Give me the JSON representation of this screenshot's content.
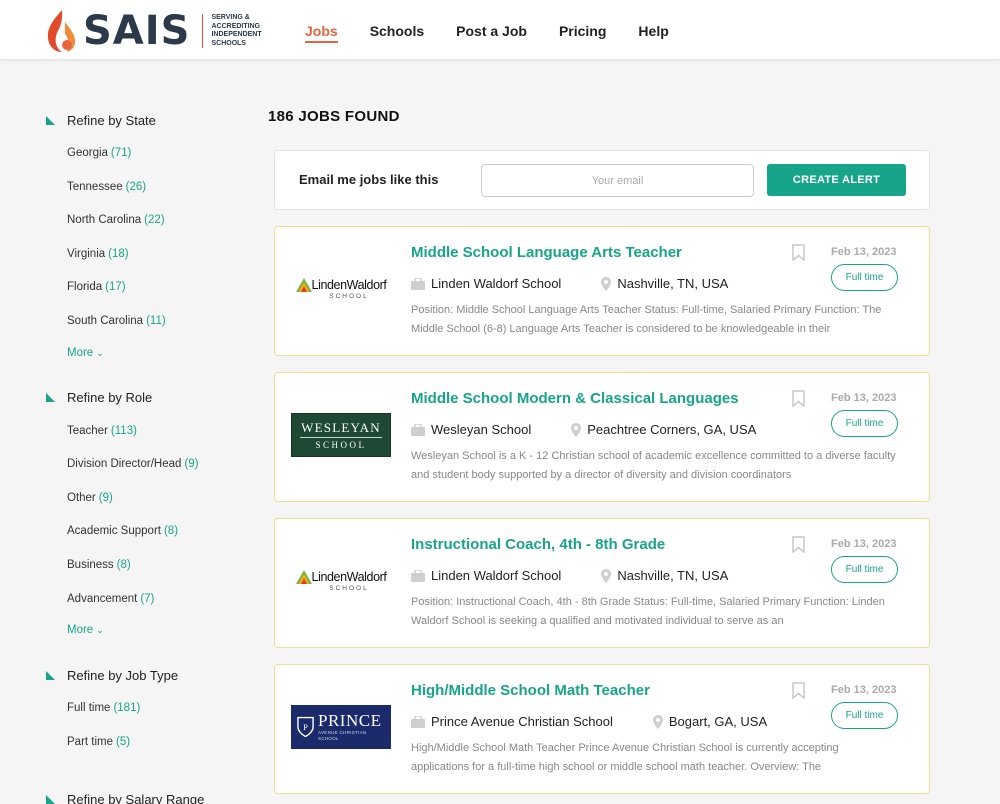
{
  "brand": {
    "name": "SAIS",
    "tagline": [
      "SERVING &",
      "ACCREDITING",
      "INDEPENDENT",
      "SCHOOLS"
    ],
    "accent": "#e8643c",
    "navy": "#2b3a4a"
  },
  "nav": {
    "items": [
      {
        "label": "Jobs",
        "active": true
      },
      {
        "label": "Schools"
      },
      {
        "label": "Post a Job"
      },
      {
        "label": "Pricing"
      },
      {
        "label": "Help"
      }
    ]
  },
  "colors": {
    "teal": "#17a589",
    "card_border": "#f0e08a"
  },
  "filters": {
    "state": {
      "title": "Refine by State",
      "items": [
        {
          "label": "Georgia",
          "count": "(71)"
        },
        {
          "label": "Tennessee",
          "count": "(26)"
        },
        {
          "label": "North Carolina",
          "count": "(22)"
        },
        {
          "label": "Virginia",
          "count": "(18)"
        },
        {
          "label": "Florida",
          "count": "(17)"
        },
        {
          "label": "South Carolina",
          "count": "(11)"
        }
      ],
      "more": "More"
    },
    "role": {
      "title": "Refine by Role",
      "items": [
        {
          "label": "Teacher",
          "count": "(113)"
        },
        {
          "label": "Division Director/Head",
          "count": "(9)"
        },
        {
          "label": "Other",
          "count": "(9)"
        },
        {
          "label": "Academic Support",
          "count": "(8)"
        },
        {
          "label": "Business",
          "count": "(8)"
        },
        {
          "label": "Advancement",
          "count": "(7)"
        }
      ],
      "more": "More"
    },
    "job_type": {
      "title": "Refine by Job Type",
      "items": [
        {
          "label": "Full time",
          "count": "(181)"
        },
        {
          "label": "Part time",
          "count": "(5)"
        }
      ]
    },
    "salary": {
      "title": "Refine by Salary Range"
    }
  },
  "results": {
    "count_label": "186 JOBS FOUND"
  },
  "alert": {
    "label": "Email me jobs like this",
    "placeholder": "Your email",
    "button": "CREATE ALERT"
  },
  "jobs": [
    {
      "title": "Middle School Language Arts Teacher",
      "school": "Linden Waldorf School",
      "location": "Nashville, TN, USA",
      "date": "Feb 13, 2023",
      "type": "Full time",
      "desc": "Position: Middle School Language Arts Teacher Status: Full-time, Salaried Primary Function: The Middle School (6-8) Language Arts Teacher is considered to be knowledgeable in their",
      "logo": "linden"
    },
    {
      "title": "Middle School Modern & Classical Languages",
      "school": "Wesleyan School",
      "location": "Peachtree Corners, GA, USA",
      "date": "Feb 13, 2023",
      "type": "Full time",
      "desc": "Wesleyan School is a K - 12 Christian school of academic excellence committed to a diverse faculty and student body supported by a director of diversity and division coordinators",
      "logo": "wesleyan"
    },
    {
      "title": "Instructional Coach, 4th - 8th Grade",
      "school": "Linden Waldorf School",
      "location": "Nashville, TN, USA",
      "date": "Feb 13, 2023",
      "type": "Full time",
      "desc": "Position: Instructional Coach, 4th - 8th Grade Status: Full-time, Salaried Primary Function: Linden Waldorf School is seeking a qualified and motivated individual to serve as an",
      "logo": "linden"
    },
    {
      "title": "High/Middle School Math Teacher",
      "school": "Prince Avenue Christian School",
      "location": "Bogart, GA, USA",
      "date": "Feb 13, 2023",
      "type": "Full time",
      "desc": "High/Middle School Math Teacher   Prince Avenue Christian School is currently accepting applications for a full-time high school or middle school math teacher. Overview: The",
      "logo": "prince"
    }
  ],
  "logos": {
    "linden": {
      "text": "LindenWaldorf",
      "sub": "SCHOOL"
    },
    "wesleyan": {
      "line1": "WESLEYAN",
      "line2": "SCHOOL"
    },
    "prince": {
      "line1": "PRINCE",
      "line2": "AVENUE CHRISTIAN SCHOOL"
    }
  }
}
